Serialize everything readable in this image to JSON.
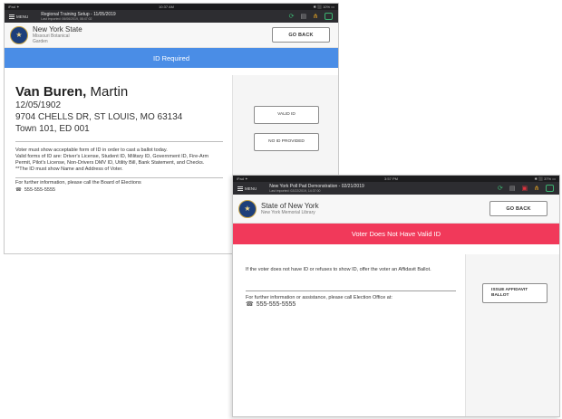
{
  "screen1": {
    "status_carrier": "iPad ✦",
    "status_time": "10:37 AM",
    "status_battery": "✱ ⬛ 10% ▭",
    "menu_label": "MENU",
    "app_title": "Regional Training Setup - 11/05/2019",
    "app_subtitle": "Last imported: 06/06/2019, 08:47:02",
    "venue_name": "New York State",
    "venue_sub1": "Missouri Botanical",
    "venue_sub2": "Garden",
    "go_back": "GO BACK",
    "banner": "ID Required",
    "voter": {
      "last_name": "Van Buren,",
      "first_name": "Martin",
      "dob": "12/05/1902",
      "address": "9704 CHELLS DR, ST LOUIS, MO 63134",
      "district": "Town 101, ED 001"
    },
    "message": "Voter must show acceptable form of ID in order to cast a ballot today.",
    "valid_forms": "Valid forms of ID are: Driver's License, Student ID, Military ID, Government ID, Fire-Arm Permit, Pilot's License, Non-Drivers DMV ID, Utility Bill, Bank Statement, and Checks.",
    "note": "**The ID must show Name and Address of Voter.",
    "further_info": "For further information, please call the Board of Elections",
    "phone": "555-555-5555",
    "buttons": {
      "valid_id": "VALID ID",
      "no_id": "NO ID PROVIDED"
    }
  },
  "screen2": {
    "status_carrier": "iPad ✦",
    "status_time": "3:57 PM",
    "status_battery": "✱ ⬛ 37% ▭",
    "menu_label": "MENU",
    "app_title": "New York Poll Pad Demonstration - 02/21/2019",
    "app_subtitle": "Last imported: 02/22/2019, 14:37:00",
    "venue_name": "State of New York",
    "venue_sub": "New York Memorial Library",
    "go_back": "GO BACK",
    "banner": "Voter Does Not Have Valid ID",
    "message": "If the voter does not have ID or refuses to show ID, offer the voter an Affidavit Ballot.",
    "further_info": "For further information or assistance, please call Election Office at:",
    "phone": "555-555-5555",
    "buttons": {
      "issue_affidavit": "ISSUE AFFIDAVIT BALLOT"
    }
  },
  "icons": {
    "seal": "state-seal-icon",
    "sync": "sync-icon",
    "barcode": "barcode-icon",
    "network": "network-icon",
    "battery": "battery-status-icon",
    "phone": "phone-icon"
  },
  "colors": {
    "id_required_banner": "#4a8de6",
    "no_valid_id_banner": "#f1395a",
    "app_bar": "#2d2d31"
  }
}
